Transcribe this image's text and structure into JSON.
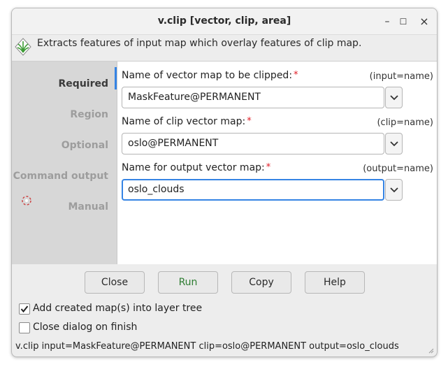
{
  "window": {
    "title": "v.clip [vector, clip, area]",
    "controls": {
      "minimize": "–",
      "maximize": "☐",
      "close": "×"
    }
  },
  "description": "Extracts features of input map which overlay features of clip map.",
  "sidebar": {
    "items": [
      {
        "label": "Required",
        "active": true
      },
      {
        "label": "Region",
        "active": false
      },
      {
        "label": "Optional",
        "active": false
      },
      {
        "label": "Command output",
        "active": false
      },
      {
        "label": "Manual",
        "active": false
      }
    ]
  },
  "fields": [
    {
      "label": "Name of vector map to be clipped:",
      "required_mark": "*",
      "key": "(input=name)",
      "value": "MaskFeature@PERMANENT"
    },
    {
      "label": "Name of clip vector map:",
      "required_mark": "*",
      "key": "(clip=name)",
      "value": "oslo@PERMANENT"
    },
    {
      "label": "Name for output vector map:",
      "required_mark": "*",
      "key": "(output=name)",
      "value": "oslo_clouds"
    }
  ],
  "buttons": {
    "close": "Close",
    "run": "Run",
    "copy": "Copy",
    "help": "Help"
  },
  "options": {
    "add_to_layer_tree": {
      "label": "Add created map(s) into layer tree",
      "checked": true
    },
    "close_on_finish": {
      "label": "Close dialog on finish",
      "checked": false
    }
  },
  "command_line": "v.clip input=MaskFeature@PERMANENT clip=oslo@PERMANENT output=oslo_clouds",
  "colors": {
    "accent": "#3584e4",
    "required": "#e01b24",
    "run_text": "#2e7d32"
  }
}
